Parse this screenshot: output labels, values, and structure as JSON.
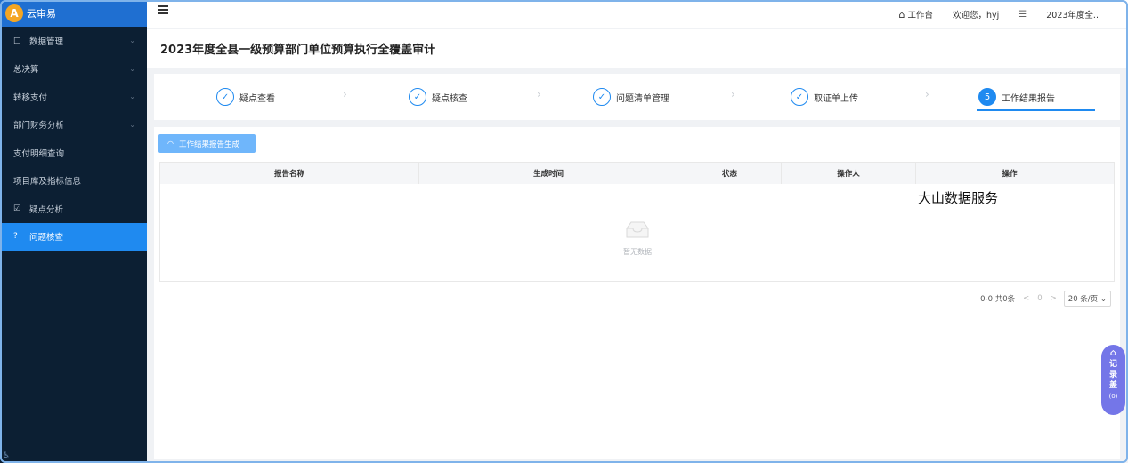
{
  "app": {
    "name": "云审易",
    "logo_mark": "A"
  },
  "sidebar": {
    "items": [
      {
        "label": "数据管理",
        "icon": "□",
        "has_chevron": true
      },
      {
        "label": "总决算",
        "icon": "",
        "has_chevron": true
      },
      {
        "label": "转移支付",
        "icon": "",
        "has_chevron": true
      },
      {
        "label": "部门财务分析",
        "icon": "",
        "has_chevron": true
      },
      {
        "label": "支付明细查询",
        "icon": "",
        "has_chevron": false
      },
      {
        "label": "项目库及指标信息",
        "icon": "",
        "has_chevron": false
      },
      {
        "label": "疑点分析",
        "icon": "☑",
        "has_chevron": false
      },
      {
        "label": "问题核查",
        "icon": "?",
        "has_chevron": false
      }
    ],
    "chevron": "⌄"
  },
  "header": {
    "workbench_label": "工作台",
    "welcome": "欢迎您，hyj",
    "year_label": "2023年度全..."
  },
  "page": {
    "title": "2023年度全县一级预算部门单位预算执行全覆盖审计"
  },
  "steps": [
    {
      "label": "疑点查看",
      "mark": "✓"
    },
    {
      "label": "疑点核查",
      "mark": "✓"
    },
    {
      "label": "问题清单管理",
      "mark": "✓"
    },
    {
      "label": "取证单上传",
      "mark": "✓"
    },
    {
      "label": "工作结果报告",
      "mark": "5"
    }
  ],
  "step_separator": "›",
  "actions": {
    "generate_label": "工作结果报告生成"
  },
  "table": {
    "columns": [
      "报告名称",
      "生成时间",
      "状态",
      "操作人",
      "操作"
    ],
    "rows": [],
    "empty_text": "暂无数据"
  },
  "watermark": "大山数据服务",
  "pagination": {
    "summary": "0-0 共0条",
    "prev": "<",
    "current": "0",
    "next": ">",
    "page_size": "20 条/页 ⌄"
  },
  "float_widget": {
    "chars": [
      "记",
      "录",
      "盖"
    ],
    "count": "(0)"
  },
  "colors": {
    "accent": "#1f8af0",
    "sidebar_bg": "#0c1f33",
    "widget": "#7476e8"
  }
}
